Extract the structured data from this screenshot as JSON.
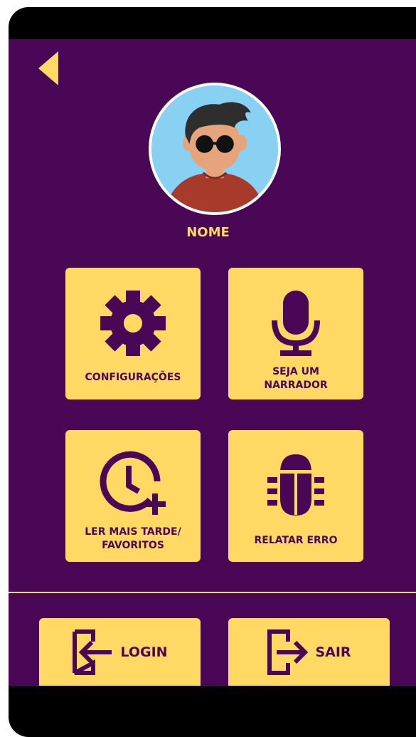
{
  "colors": {
    "background": "#4a0755",
    "accent": "#ffd964",
    "frame": "#000000"
  },
  "header": {
    "back_icon": "back-arrow-icon"
  },
  "profile": {
    "name": "NOME",
    "avatar_icon": "avatar-icon"
  },
  "menu": {
    "tiles": [
      {
        "label": "CONFIGURAÇÕES",
        "icon": "gear-icon"
      },
      {
        "label_lines": [
          "SEJA UM",
          "NARRADOR"
        ],
        "icon": "microphone-icon"
      },
      {
        "label_lines": [
          "LER MAIS TARDE/",
          "FAVORITOS"
        ],
        "icon": "clock-plus-icon"
      },
      {
        "label": "RELATAR ERRO",
        "icon": "bug-icon"
      }
    ]
  },
  "footer": {
    "login_label": "LOGIN",
    "login_icon": "login-icon",
    "exit_label": "SAIR",
    "exit_icon": "logout-icon"
  }
}
